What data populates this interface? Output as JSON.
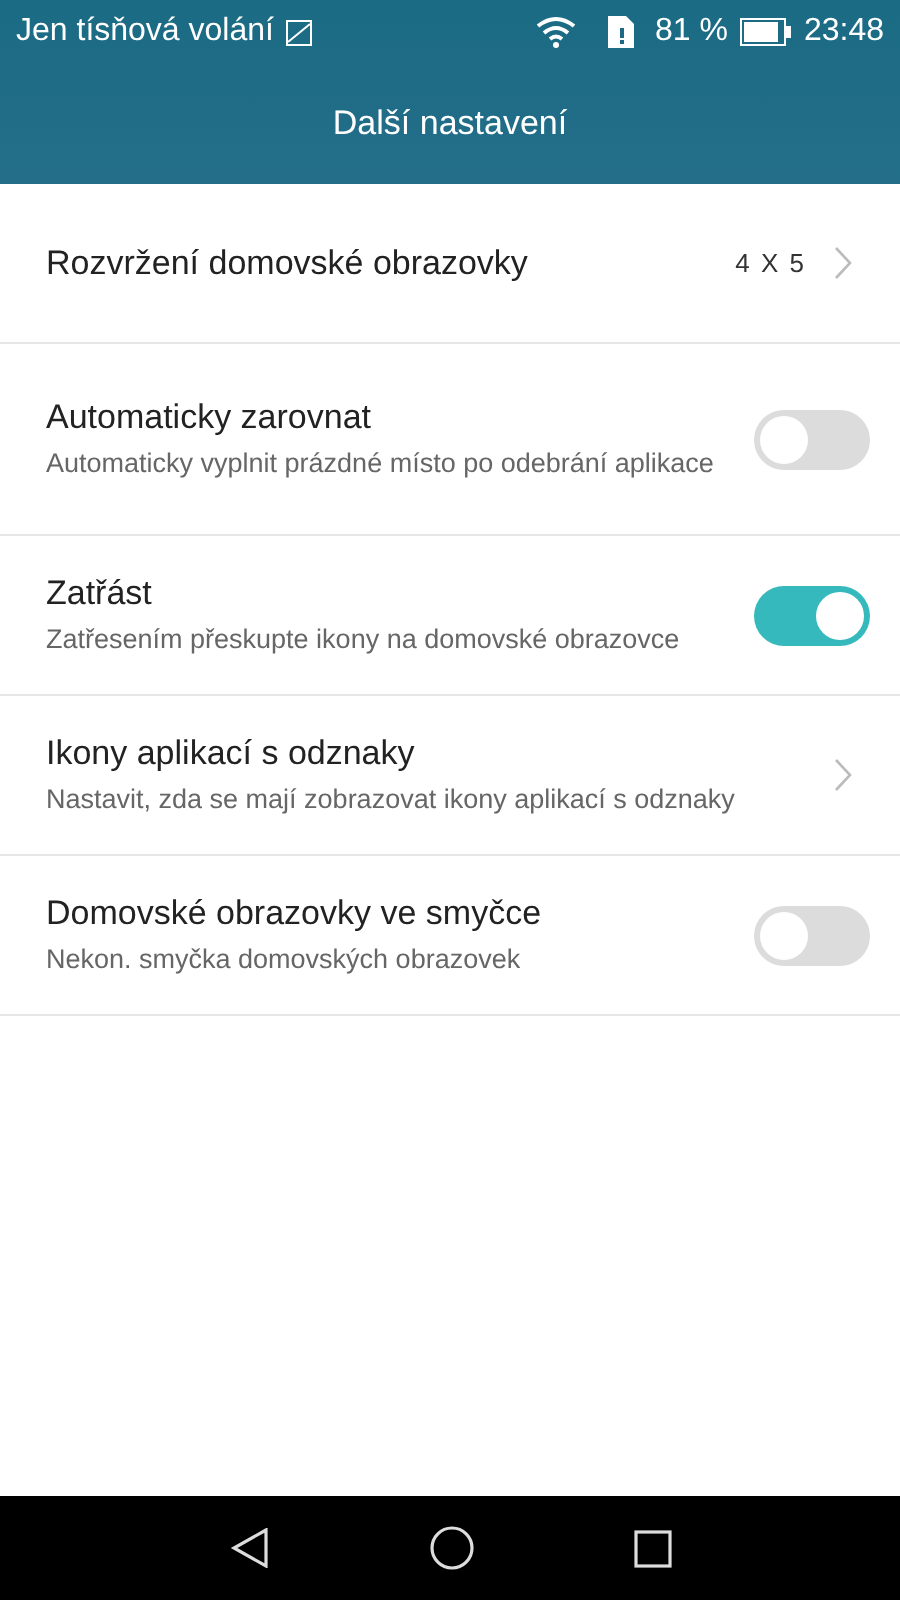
{
  "status_bar": {
    "carrier": "Jen tísňová volání",
    "battery_percent": "81 %",
    "time": "23:48"
  },
  "title": "Další nastavení",
  "settings": [
    {
      "kind": "value",
      "title": "Rozvržení domovské obrazovky",
      "value": "4 X 5"
    },
    {
      "kind": "toggle",
      "title": "Automaticky zarovnat",
      "subtitle": "Automaticky vyplnit prázdné místo po odebrání aplikace",
      "on": false
    },
    {
      "kind": "toggle",
      "title": "Zatřást",
      "subtitle": "Zatřesením přeskupte ikony na domovské obrazovce",
      "on": true
    },
    {
      "kind": "link",
      "title": "Ikony aplikací s odznaky",
      "subtitle": "Nastavit, zda se mají zobrazovat ikony aplikací s odznaky"
    },
    {
      "kind": "toggle",
      "title": "Domovské obrazovky ve smyčce",
      "subtitle": "Nekon. smyčka domovských obrazovek",
      "on": false
    }
  ]
}
